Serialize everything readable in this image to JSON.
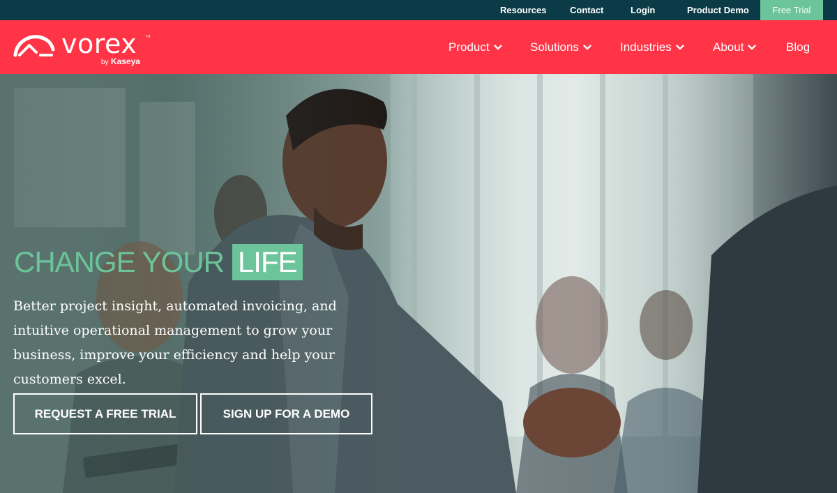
{
  "topbar": {
    "links": {
      "resources": "Resources",
      "contact": "Contact",
      "login": "Login",
      "product_demo": "Product Demo",
      "free_trial": "Free Trial"
    }
  },
  "brand": {
    "wordmark": "vorex",
    "tm": "™",
    "by": "by",
    "company": "Kaseya"
  },
  "nav": {
    "product": "Product",
    "solutions": "Solutions",
    "industries": "Industries",
    "about": "About",
    "blog": "Blog"
  },
  "hero": {
    "headline": "CHANGE YOUR",
    "headline_accent": "LIFE",
    "subcopy": "Better project insight, automated invoicing, and intuitive operational management to grow your business, improve your efficiency and help your customers excel.",
    "cta_trial": "REQUEST A FREE TRIAL",
    "cta_demo": "SIGN UP FOR A DEMO"
  },
  "colors": {
    "topbar_bg": "#0a3b47",
    "navbar_bg": "#ff3447",
    "accent_green": "#6cc49a",
    "text_white": "#ffffff"
  },
  "icons": {
    "logo": "vorex-gauge-logo",
    "nav_dropdown": "chevron-down-icon",
    "hero_image": "business-people-meeting-photo"
  }
}
